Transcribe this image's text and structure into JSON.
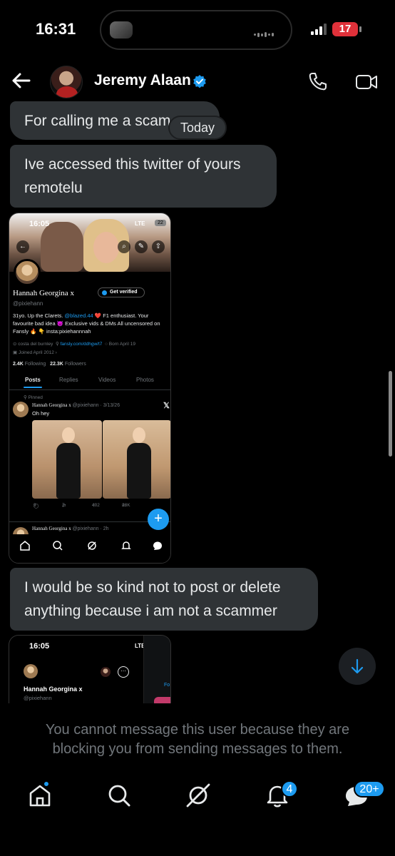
{
  "status_bar": {
    "time": "16:31",
    "battery": "17"
  },
  "header": {
    "contact_name": "Jeremy Alaan"
  },
  "messages": {
    "m1": "For calling me a scam",
    "date_divider": "Today",
    "m2": "Ive accessed this twitter of yours remotelu",
    "m3": "I would be so kind not to post or delete anything because i am not a scammer"
  },
  "screenshot1": {
    "time": "16:05",
    "lte": "LTE",
    "battery": "22",
    "profile_name": "Hannah Georgina x",
    "get_verified": "Get verified",
    "handle": "@pixiehann",
    "bio_line1_a": "31yo. Up the Clarets. ",
    "bio_mention": "@blazed.44",
    "bio_line1_b": " ❤️ F1 enthusiast. Your favourite bad idea 😈 Exclusive vids & DMs All uncensored on Fansly 🔥 👇 insta:pixiehannnah",
    "location": "costa del burnley",
    "link": "fansly.com/ddhgw/t7",
    "born": "Born April 19",
    "joined": "Joined April 2012",
    "following_count": "2.4K",
    "following_label": "Following",
    "followers_count": "22.3K",
    "followers_label": "Followers",
    "tabs": [
      "Posts",
      "Replies",
      "Videos",
      "Photos"
    ],
    "pinned_label": "Pinned",
    "post_name": "Hannah Georgina x",
    "post_meta": "@pixiehann · 3/13/26",
    "post_text": "Oh hey",
    "replies": "9",
    "reposts": "7",
    "likes": "402",
    "views": "28K",
    "post2_name": "Hannah Georgina x",
    "post2_meta": "@pixiehann · 2h"
  },
  "screenshot2": {
    "time": "16:05",
    "lte": "LTE",
    "battery": "22",
    "profile_name": "Hannah Georgina x",
    "handle": "@pixiehann",
    "side_tab": "Fo"
  },
  "blocked_notice": "You cannot message this user because they are blocking you from sending messages to them.",
  "bottom_nav": {
    "notifications_badge": "4",
    "messages_badge": "20+"
  },
  "colors": {
    "accent": "#1d9bf0",
    "bubble": "#2f3336",
    "muted_text": "#71767b"
  }
}
